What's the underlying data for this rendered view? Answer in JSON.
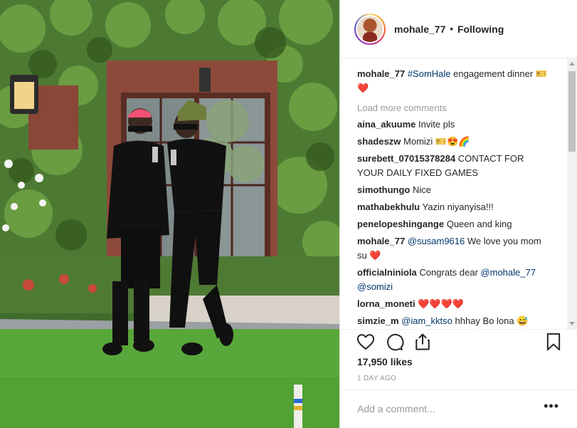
{
  "post": {
    "username": "mohale_77",
    "separator": "•",
    "follow_status": "Following",
    "caption_user": "mohale_77",
    "caption_tag": "#SomHale",
    "caption_text": "engagement dinner",
    "caption_emoji": "🎫❤️",
    "load_more": "Load more comments",
    "likes": "17,950 likes",
    "time_ago": "1 DAY AGO",
    "add_comment_placeholder": "Add a comment...",
    "more_label": "•••"
  },
  "comments": [
    {
      "user": "aina_akuume",
      "parts": [
        {
          "t": "Invite pls"
        }
      ]
    },
    {
      "user": "shadeszw",
      "parts": [
        {
          "t": "Momizi 🎫😍🌈"
        }
      ]
    },
    {
      "user": "surebett_07015378284",
      "parts": [
        {
          "t": "CONTACT FOR YOUR DAILY FIXED GAMES"
        }
      ]
    },
    {
      "user": "simothungo",
      "parts": [
        {
          "t": "Nice"
        }
      ]
    },
    {
      "user": "mathabekhulu",
      "parts": [
        {
          "t": "Yazin niyanyisa!!!"
        }
      ]
    },
    {
      "user": "penelopeshingange",
      "parts": [
        {
          "t": "Queen and king"
        }
      ]
    },
    {
      "user": "mohale_77",
      "parts": [
        {
          "t": "@susam9616",
          "tag": true
        },
        {
          "t": " We love you mom su ❤️"
        }
      ]
    },
    {
      "user": "officialniniola",
      "parts": [
        {
          "t": "Congrats dear "
        },
        {
          "t": "@mohale_77",
          "tag": true
        },
        {
          "t": " "
        },
        {
          "t": "@somizi",
          "tag": true
        }
      ]
    },
    {
      "user": "lorna_moneti",
      "parts": [
        {
          "t": "❤️❤️❤️❤️"
        }
      ]
    },
    {
      "user": "simzie_m",
      "parts": [
        {
          "t": "@iam_kktso",
          "tag": true
        },
        {
          "t": " hhhay Bo lona 😅"
        }
      ]
    }
  ],
  "icons": {
    "like": "heart-icon",
    "comment": "comment-icon",
    "share": "share-icon",
    "save": "bookmark-icon"
  },
  "colors": {
    "tag": "#00376b",
    "muted": "#999999",
    "text": "#262626"
  }
}
